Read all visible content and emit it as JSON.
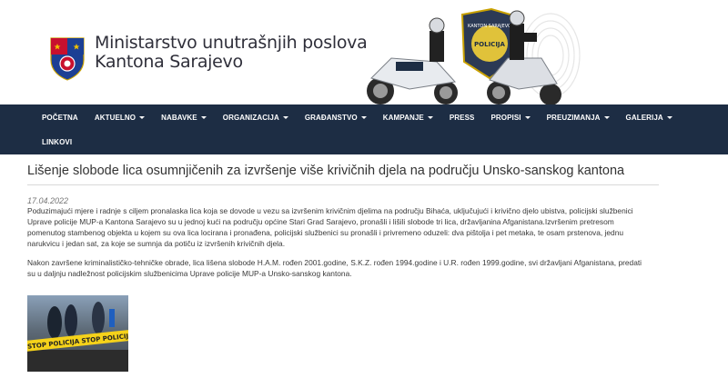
{
  "header": {
    "title_line1": "Ministarstvo unutrašnjih poslova",
    "title_line2": "Kantona Sarajevo",
    "badge_text_top": "KANTON SARAJEVO",
    "badge_text_main": "POLICIJA"
  },
  "nav": {
    "items": [
      {
        "label": "POČETNA",
        "dropdown": false
      },
      {
        "label": "AKTUELNO",
        "dropdown": true
      },
      {
        "label": "NABAVKE",
        "dropdown": true
      },
      {
        "label": "ORGANIZACIJA",
        "dropdown": true
      },
      {
        "label": "GRAĐANSTVO",
        "dropdown": true
      },
      {
        "label": "KAMPANJE",
        "dropdown": true
      },
      {
        "label": "PRESS",
        "dropdown": false
      },
      {
        "label": "PROPISI",
        "dropdown": true
      },
      {
        "label": "PREUZIMANJA",
        "dropdown": true
      },
      {
        "label": "GALERIJA",
        "dropdown": true
      },
      {
        "label": "LINKOVI",
        "dropdown": false
      }
    ]
  },
  "article": {
    "title": "Lišenje slobode lica osumnjičenih za izvršenje više krivičnih djela na području Unsko-sanskog kantona",
    "date": "17.04.2022",
    "paragraph1_lines": [
      "Poduzimajući mjere i radnje s ciljem pronalaska lica koja se dovode u vezu sa izvršenim krivičnim djelima na području Bihaća, uključujući i krivično djelo ubistva, policijski službenici",
      "Uprave policije MUP-a Kantona Sarajevo su u jednoj kući na području općine Stari Grad Sarajevo, pronašli i lišili slobode tri lica, državljanina Afganistana.Izvršenim pretresom",
      "pomenutog stambenog objekta u kojem su ova lica locirana i pronađena, policijski službenici su pronašli i privremeno oduzeli: dva pištolja i pet metaka, te osam prstenova, jednu",
      "narukvicu i jedan sat, za koje se sumnja da potiču iz izvršenih krivičnih djela."
    ],
    "paragraph2_lines": [
      "Nakon završene kriminalističko-tehničke obrade, lica lišena slobode H.A.M. rođen 2001.godine, S.K.Z. rođen 1994.godine i U.R. rođen 1999.godine, svi državljani Afganistana, predati",
      "su u daljnju nadležnost policijskim službenicima Uprave policije MUP-a Unsko-sanskog kantona."
    ],
    "photo_tape_text": "STOP POLICIJA   STOP POLICIJA"
  },
  "colors": {
    "nav_bg": "#1d2d44",
    "nav_text": "#ffffff",
    "crest_blue": "#1c3f94",
    "crest_red": "#c8102e",
    "crest_gold": "#f2c200",
    "tape_yellow": "#f5d21a"
  }
}
